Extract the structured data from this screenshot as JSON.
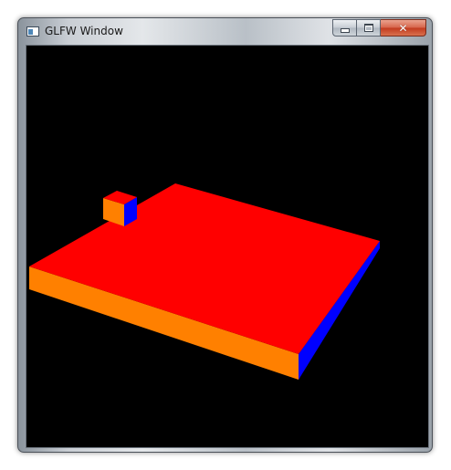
{
  "window": {
    "title": "GLFW Window"
  },
  "caption_buttons": {
    "minimize_icon": "minimize-icon",
    "maximize_icon": "maximize-icon",
    "close_icon": "close-icon",
    "close_glyph": "✕"
  },
  "viewport": {
    "background_color": "#000000"
  },
  "scene_colors": {
    "top_face": "#ff0000",
    "front_face": "#ff8000",
    "side_face": "#0000ff"
  }
}
